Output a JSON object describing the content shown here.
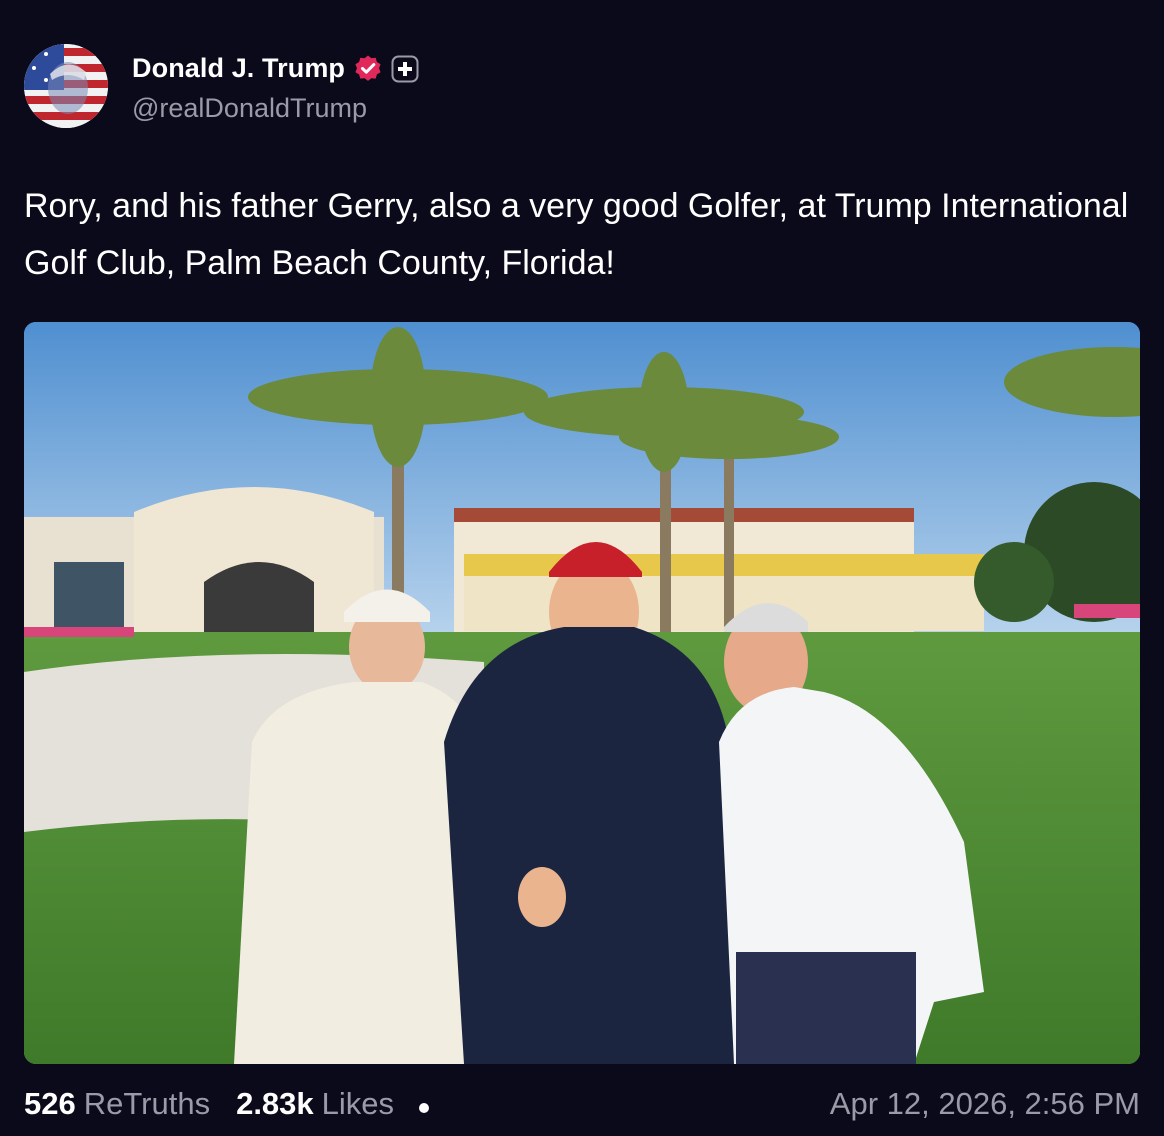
{
  "author": {
    "display_name": "Donald J. Trump",
    "handle": "@realDonaldTrump",
    "verified_badge_color": "#e0285a"
  },
  "post": {
    "text": "Rory, and his father Gerry, also a very good Golfer, at Trump International Golf Club, Palm Beach County, Florida!",
    "image_alt": "Three men posing on a golf course in front of a clubhouse with palm trees"
  },
  "stats": {
    "retruths_count": "526",
    "retruths_label": "ReTruths",
    "likes_count": "2.83k",
    "likes_label": "Likes"
  },
  "timestamp": "Apr 12, 2026, 2:56 PM",
  "colors": {
    "background": "#0a0a1a",
    "text_primary": "#ffffff",
    "text_secondary": "#9a9aa8"
  },
  "icons": {
    "verified": "verified-badge-icon",
    "plus": "plus-badge-icon",
    "more": "dot-icon"
  }
}
